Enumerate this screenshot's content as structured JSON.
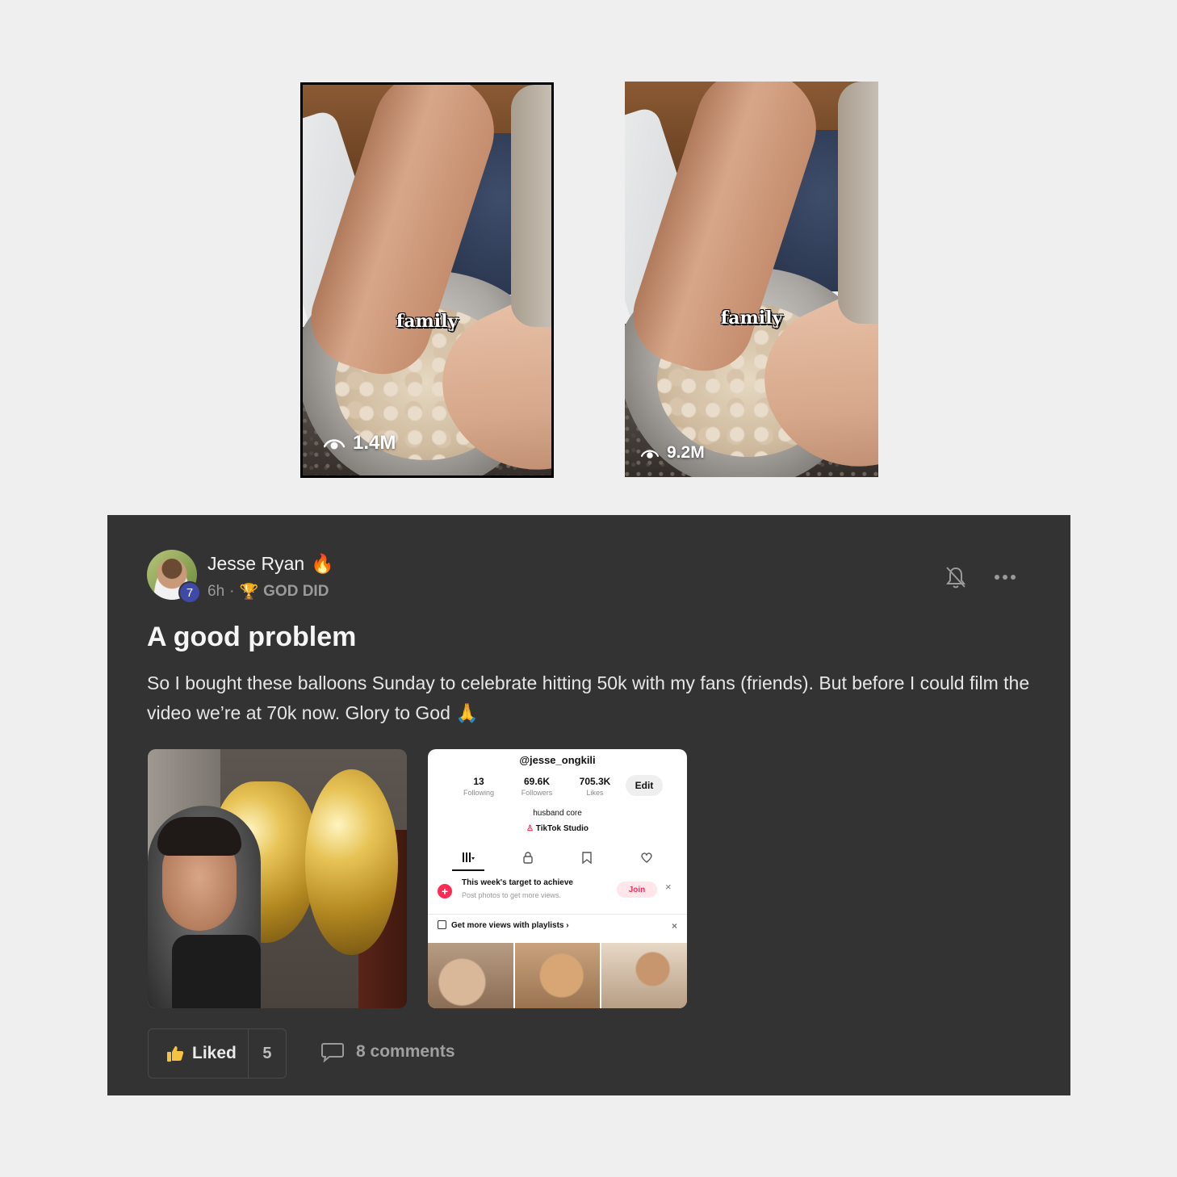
{
  "videos": [
    {
      "caption_word": "family",
      "views": "1.4M",
      "selected": true
    },
    {
      "caption_word": "family",
      "views": "9.2M",
      "selected": false
    }
  ],
  "post": {
    "author": {
      "name": "Jesse Ryan",
      "name_emoji": "🔥",
      "level": "7",
      "time": "6h",
      "separator": "·",
      "tag_emoji": "🏆",
      "tag": "GOD DID"
    },
    "title": "A good problem",
    "body": "So I bought these balloons Sunday to celebrate hitting 50k with my fans (friends). But before I could film the video we’re at 70k now. Glory to God 🙏",
    "icons": {
      "bell": "bell-off-icon",
      "more": "more-icon"
    },
    "attachments": {
      "tiktok": {
        "handle": "@jesse_ongkili",
        "stats": [
          {
            "num": "13",
            "label": "Following"
          },
          {
            "num": "69.6K",
            "label": "Followers"
          },
          {
            "num": "705.3K",
            "label": "Likes"
          }
        ],
        "edit_label": "Edit",
        "bio": "husband core",
        "studio_label": "TikTok Studio",
        "target_title": "This week's target to achieve",
        "target_sub": "Post photos to get more views.",
        "join_label": "Join",
        "playlist_label": "Get more views with playlists ›",
        "close_glyph": "×"
      }
    },
    "footer": {
      "liked_label": "Liked",
      "like_count": "5",
      "comments_label": "8 comments"
    }
  },
  "colors": {
    "page_bg": "#efefef",
    "card_bg": "#333333",
    "level_badge": "#3f49a8",
    "tiktok_red": "#fe2c55"
  }
}
